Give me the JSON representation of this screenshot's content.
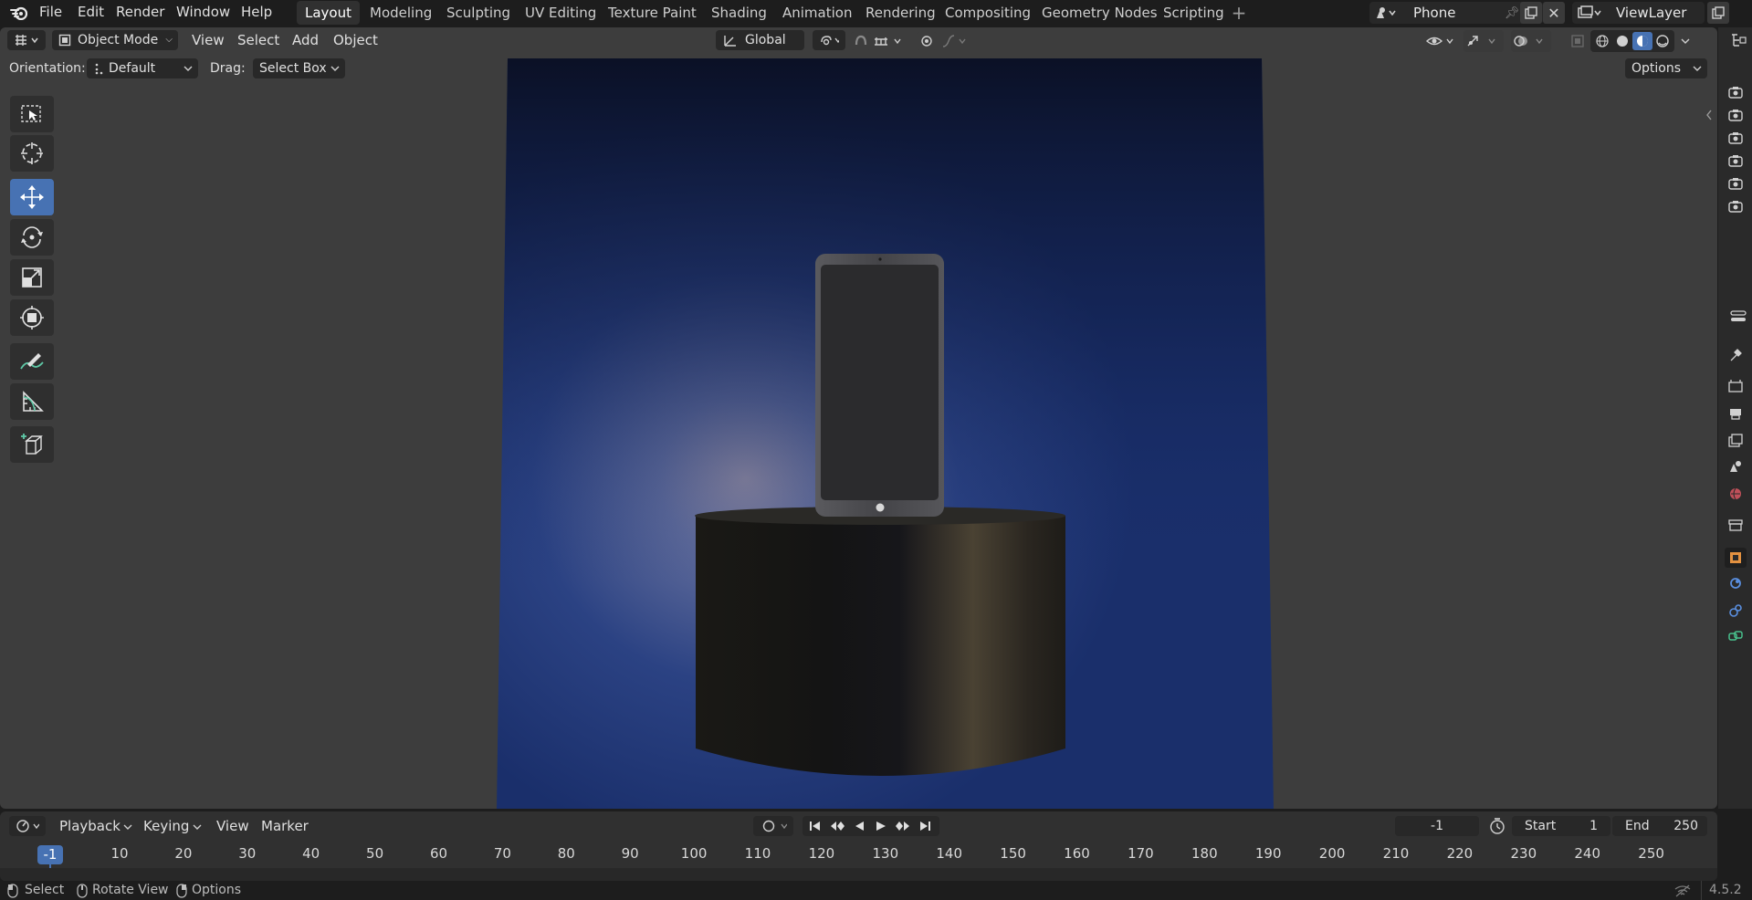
{
  "app": {
    "logo_icon": "blender-logo-icon"
  },
  "menu": {
    "file": "File",
    "edit": "Edit",
    "render": "Render",
    "window": "Window",
    "help": "Help"
  },
  "workspaces": [
    "Layout",
    "Modeling",
    "Sculpting",
    "UV Editing",
    "Texture Paint",
    "Shading",
    "Animation",
    "Rendering",
    "Compositing",
    "Geometry Nodes",
    "Scripting"
  ],
  "scene": {
    "name": "Phone",
    "view_layer": "ViewLayer"
  },
  "viewport_header": {
    "mode": "Object Mode",
    "view": "View",
    "select": "Select",
    "add": "Add",
    "object": "Object",
    "transform_orientation": "Global"
  },
  "tool_settings": {
    "orientation_label": "Orientation:",
    "orientation_value": "Default",
    "drag_label": "Drag:",
    "drag_value": "Select Box",
    "options": "Options"
  },
  "tools": [
    "select-box-icon",
    "cursor-icon",
    "move-icon",
    "rotate-icon",
    "scale-icon",
    "transform-icon",
    "annotate-icon",
    "measure-icon",
    "add-cube-icon"
  ],
  "timeline": {
    "playback": "Playback",
    "keying": "Keying",
    "view": "View",
    "marker": "Marker",
    "current_frame": "-1",
    "start_label": "Start",
    "start_value": "1",
    "end_label": "End",
    "end_value": "250",
    "ruler_current": "-1",
    "ticks": [
      "10",
      "20",
      "30",
      "40",
      "50",
      "60",
      "70",
      "80",
      "90",
      "100",
      "110",
      "120",
      "130",
      "140",
      "150",
      "160",
      "170",
      "180",
      "190",
      "200",
      "210",
      "220",
      "230",
      "240",
      "250"
    ]
  },
  "statusbar": {
    "select": "Select",
    "rotate_view": "Rotate View",
    "options": "Options",
    "version": "4.5.2"
  },
  "colors": {
    "accent": "#4772b3",
    "background": "#1d1d1d",
    "header": "#303030",
    "viewport": "#3d3d3d"
  }
}
